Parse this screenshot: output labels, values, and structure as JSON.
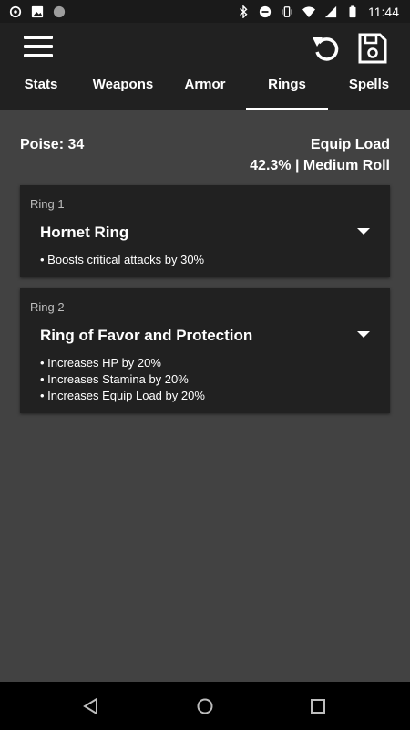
{
  "status_bar": {
    "time": "11:44",
    "left_icons": [
      "sync-icon",
      "image-icon",
      "record-icon"
    ],
    "right_icons": [
      "bluetooth-icon",
      "do-not-disturb-icon",
      "vibrate-icon",
      "wifi-icon",
      "signal-icon",
      "battery-icon"
    ]
  },
  "app_bar": {
    "menu_icon": "hamburger-menu-icon",
    "reset_icon": "reset-icon",
    "save_icon": "save-icon"
  },
  "tabs": [
    {
      "label": "Stats",
      "selected": false
    },
    {
      "label": "Weapons",
      "selected": false
    },
    {
      "label": "Armor",
      "selected": false
    },
    {
      "label": "Rings",
      "selected": true
    },
    {
      "label": "Spells",
      "selected": false
    }
  ],
  "summary": {
    "poise": "Poise: 34",
    "equip_load_title": "Equip Load",
    "equip_load_value": "42.3% | Medium Roll"
  },
  "rings": [
    {
      "label": "Ring 1",
      "name": "Hornet Ring",
      "effects": [
        "• Boosts critical attacks by 30%"
      ]
    },
    {
      "label": "Ring 2",
      "name": "Ring of Favor and Protection",
      "effects": [
        "• Increases HP by 20%",
        "• Increases Stamina by 20%",
        "• Increases Equip Load by 20%"
      ]
    }
  ],
  "nav_bar": {
    "back_icon": "back-icon",
    "home_icon": "home-icon",
    "recents_icon": "recents-icon"
  },
  "colors": {
    "background": "#424242",
    "app_bar": "#212121",
    "card": "#212121",
    "status_bar": "#1a1a1a",
    "nav_bar": "#000000",
    "text": "#ffffff",
    "label_text": "#bdbdbd"
  }
}
